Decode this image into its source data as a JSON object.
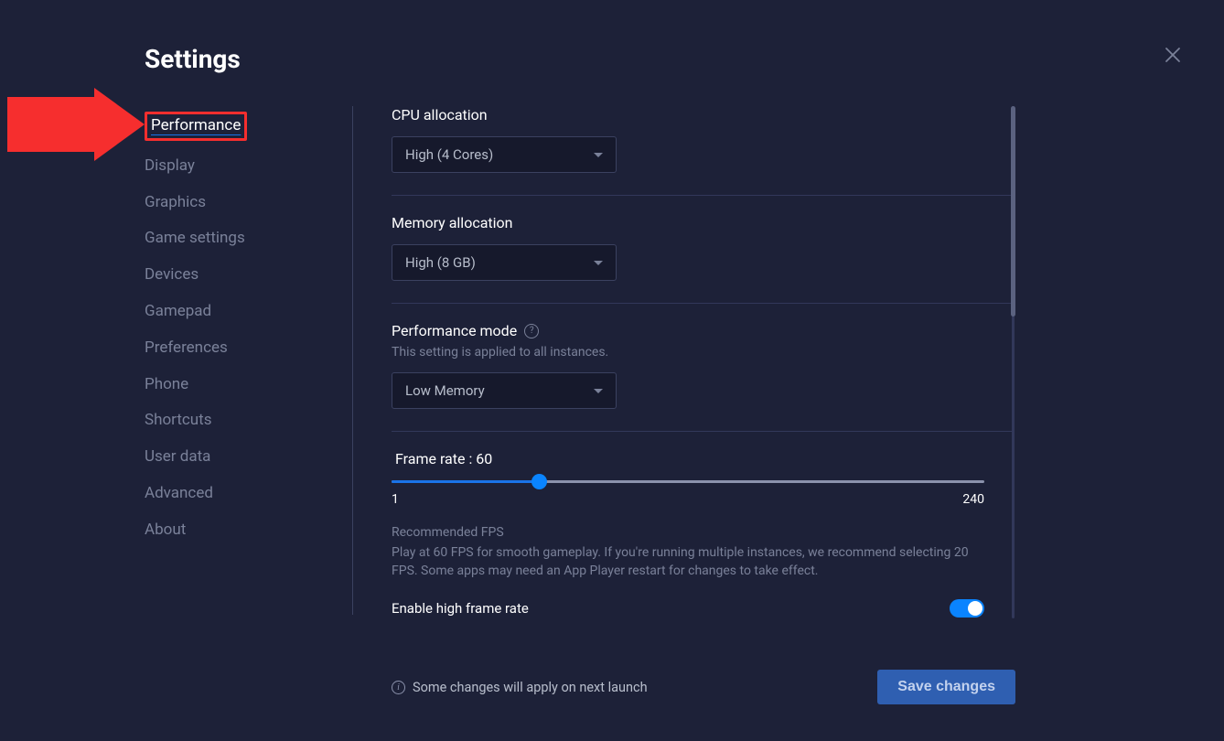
{
  "title": "Settings",
  "sidebar": {
    "items": [
      {
        "label": "Performance",
        "active": true
      },
      {
        "label": "Display"
      },
      {
        "label": "Graphics"
      },
      {
        "label": "Game settings"
      },
      {
        "label": "Devices"
      },
      {
        "label": "Gamepad"
      },
      {
        "label": "Preferences"
      },
      {
        "label": "Phone"
      },
      {
        "label": "Shortcuts"
      },
      {
        "label": "User data"
      },
      {
        "label": "Advanced"
      },
      {
        "label": "About"
      }
    ]
  },
  "cpu": {
    "label": "CPU allocation",
    "value": "High (4 Cores)"
  },
  "memory": {
    "label": "Memory allocation",
    "value": "High (8 GB)"
  },
  "perfmode": {
    "label": "Performance mode",
    "sub": "This setting is applied to all instances.",
    "value": "Low Memory"
  },
  "framerate": {
    "label": "Frame rate : 60",
    "min": "1",
    "max": "240",
    "value": 60,
    "rec_title": "Recommended FPS",
    "rec_body": "Play at 60 FPS for smooth gameplay. If you're running multiple instances, we recommend selecting 20 FPS. Some apps may need an App Player restart for changes to take effect."
  },
  "hfr": {
    "label": "Enable high frame rate",
    "on": true
  },
  "footer": {
    "note": "Some changes will apply on next launch",
    "save": "Save changes"
  },
  "annotation": {
    "arrow_color": "#f62e2e"
  }
}
